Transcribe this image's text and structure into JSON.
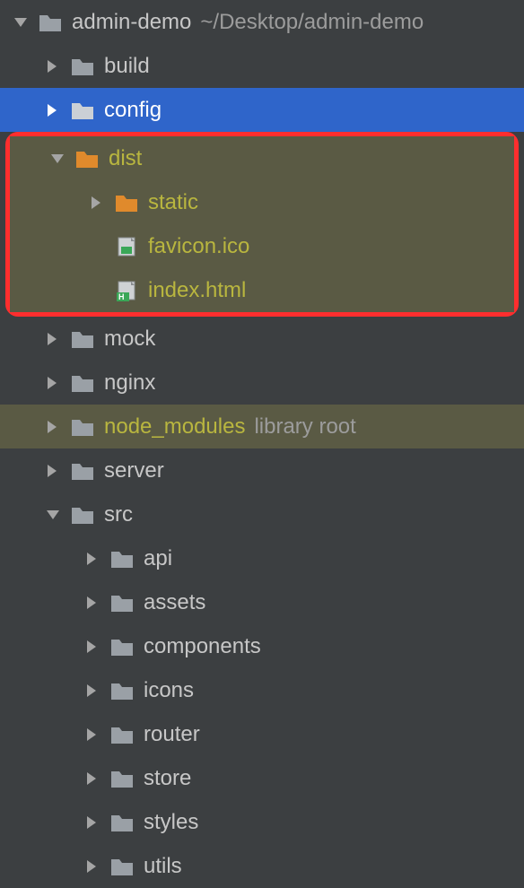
{
  "root": {
    "name": "admin-demo",
    "path": "~/Desktop/admin-demo"
  },
  "items": {
    "build": "build",
    "config": "config",
    "dist": "dist",
    "static": "static",
    "favicon": "favicon.ico",
    "index": "index.html",
    "mock": "mock",
    "nginx": "nginx",
    "node_modules": {
      "name": "node_modules",
      "note": "library root"
    },
    "server": "server",
    "src": "src",
    "api": "api",
    "assets": "assets",
    "components": "components",
    "icons": "icons",
    "router": "router",
    "store": "store",
    "styles": "styles",
    "utils": "utils"
  },
  "colors": {
    "folder_gray": "#9aa0a6",
    "folder_orange": "#e08a2c",
    "arrow_gray": "#a5a5a5",
    "arrow_white": "#ffffff",
    "olive": "#b9b63f",
    "selection": "#2f65ca"
  }
}
